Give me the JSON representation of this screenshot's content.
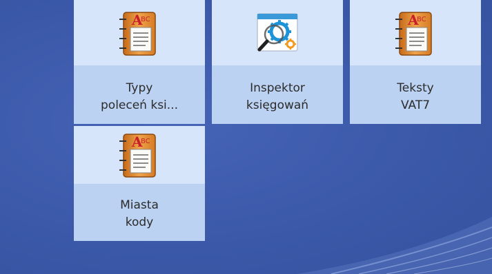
{
  "tiles": [
    {
      "line1": "Typy",
      "line2": "poleceń ksi...",
      "icon": "address-book-icon"
    },
    {
      "line1": "Inspektor",
      "line2": "księgowań",
      "icon": "inspector-gear-icon"
    },
    {
      "line1": "Teksty",
      "line2": "VAT7",
      "icon": "address-book-icon"
    },
    {
      "line1": "Miasta",
      "line2": "kody",
      "icon": "address-book-icon"
    }
  ],
  "colors": {
    "desktop": "#3d5aab",
    "tile_bg": "#bcd2f2",
    "tile_icon_band": "#d6e5f9",
    "label_text": "#2b2b2b"
  }
}
